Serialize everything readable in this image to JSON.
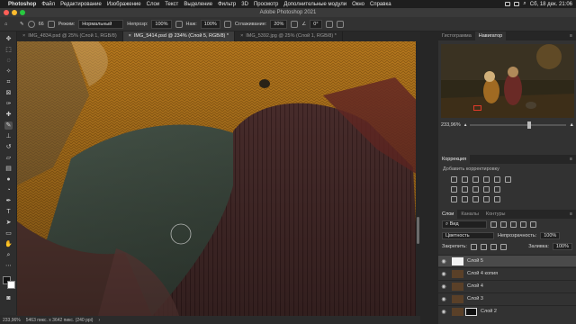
{
  "menubar": {
    "apple": "",
    "items": [
      "Photoshop",
      "Файл",
      "Редактирование",
      "Изображение",
      "Слои",
      "Текст",
      "Выделение",
      "Фильтр",
      "3D",
      "Просмотр",
      "Дополнительные модули",
      "Окно",
      "Справка"
    ],
    "clock": "Сб, 18 дек. 21:06"
  },
  "window": {
    "title": "Adobe Photoshop 2021"
  },
  "options": {
    "brush_size": "66",
    "mode_label": "Режим:",
    "mode_value": "Нормальный",
    "opacity_label": "Непрозр:",
    "opacity_value": "100%",
    "flow_label": "Наж:",
    "flow_value": "100%",
    "smoothing_label": "Сглаживание:",
    "smoothing_value": "20%",
    "angle_value": "0°"
  },
  "tabs": [
    {
      "label": "IMG_4834.psd @ 25% (Слой 1, RGB/8)",
      "active": false
    },
    {
      "label": "IMG_5414.psd @ 234% (Слой 5, RGB/8) *",
      "active": true
    },
    {
      "label": "IMG_5392.jpg @ 25% (Слой 1, RGB/8) *",
      "active": false
    }
  ],
  "status": {
    "zoom": "233,96%",
    "info": "5463 пикс. x 3642 пикс. (240 ppi)"
  },
  "navigator": {
    "tabs": [
      "Гистограмма",
      "Навигатор"
    ],
    "active_tab": 1,
    "zoom": "233,96%",
    "zoom_level": 0.6
  },
  "corrections": {
    "title": "Коррекция",
    "subtitle": "Добавить корректировку"
  },
  "layers": {
    "tabs": [
      "Слои",
      "Каналы",
      "Контуры"
    ],
    "active_tab": 0,
    "filter_label": "Вид",
    "blend_mode": "Цветность",
    "opacity_label": "Непрозрачность:",
    "opacity_value": "100%",
    "lock_label": "Закрепить:",
    "fill_label": "Заливка:",
    "fill_value": "100%",
    "items": [
      {
        "name": "Слой 5",
        "selected": true
      },
      {
        "name": "Слой 4 копия",
        "selected": false
      },
      {
        "name": "Слой 4",
        "selected": false
      },
      {
        "name": "Слой 3",
        "selected": false
      },
      {
        "name": "Слой 2",
        "selected": false
      }
    ]
  },
  "colors": {
    "accent": "#4a90d9",
    "nav_box": "#e03a2a"
  },
  "icons": {
    "eye": "eye-icon",
    "brush": "brush-icon",
    "search": "search-icon",
    "close": "close-icon"
  }
}
